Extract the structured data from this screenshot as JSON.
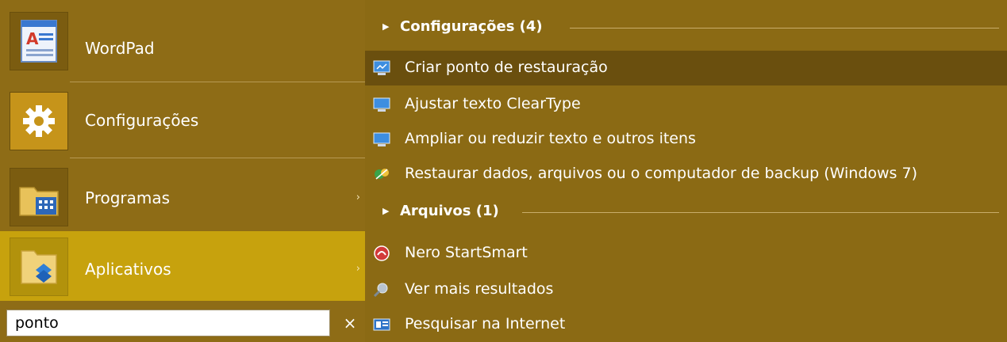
{
  "left_tiles": [
    {
      "label": "WordPad",
      "icon": "wordpad-icon"
    },
    {
      "label": "Configurações",
      "icon": "gear-icon"
    },
    {
      "label": "Programas",
      "icon": "programs-folder-icon",
      "arrow": "›"
    },
    {
      "label": "Aplicativos",
      "icon": "apps-folder-icon",
      "arrow": "›"
    }
  ],
  "search": {
    "value": "ponto",
    "clear": "×"
  },
  "groups": [
    {
      "label": "Configurações (4)"
    },
    {
      "label": "Arquivos (1)"
    }
  ],
  "items": [
    {
      "label": "Criar ponto de restauração",
      "icon": "monitor-icon"
    },
    {
      "label": "Ajustar texto ClearType",
      "icon": "monitor-icon"
    },
    {
      "label": "Ampliar ou reduzir texto e outros itens",
      "icon": "monitor-icon"
    },
    {
      "label": "Restaurar dados, arquivos ou o computador de backup (Windows 7)",
      "icon": "backup-icon"
    },
    {
      "label": "Nero StartSmart",
      "icon": "nero-icon"
    },
    {
      "label": "Ver mais resultados",
      "icon": "magnifier-icon"
    },
    {
      "label": "Pesquisar na Internet",
      "icon": "internet-search-icon"
    }
  ],
  "colors": {
    "background": "#8a6a14",
    "highlight": "#c7a20d",
    "selected": "#6a4f0e"
  }
}
